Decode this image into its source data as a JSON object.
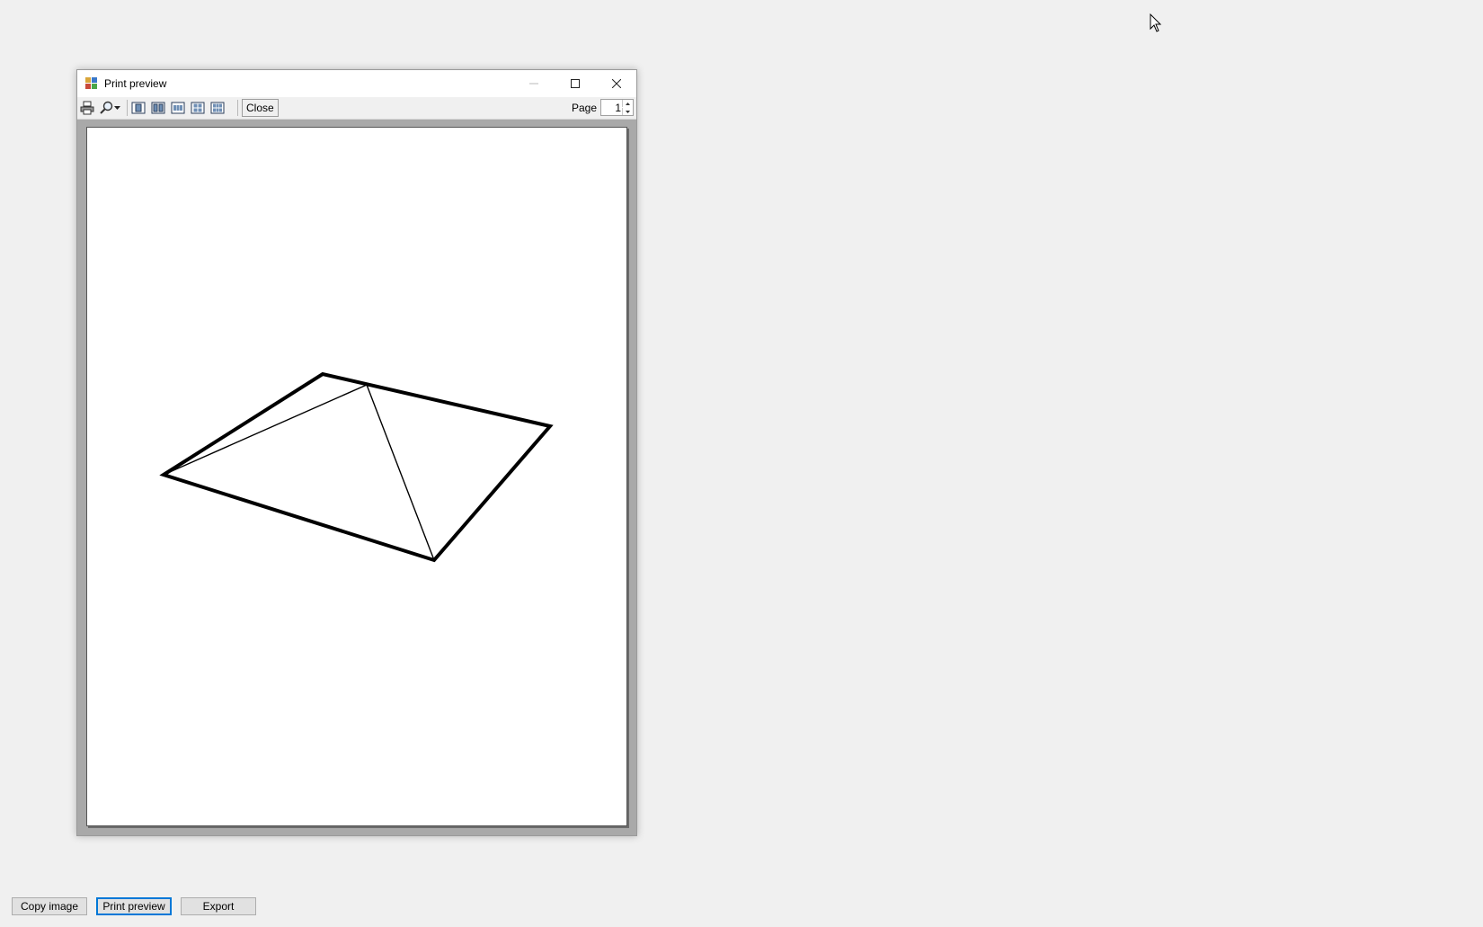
{
  "window": {
    "title": "Print preview",
    "controls": {
      "minimize": "—",
      "maximize": "☐",
      "close": "✕"
    }
  },
  "toolbar": {
    "icons": [
      "print-icon",
      "zoom-icon",
      "dropdown-arrow-icon",
      "one-page-icon",
      "two-pages-icon",
      "three-pages-icon",
      "four-pages-icon",
      "six-pages-icon"
    ],
    "close_label": "Close",
    "page_label": "Page",
    "page_value": "1"
  },
  "bottom_buttons": {
    "copy_image": "Copy image",
    "print_preview": "Print preview",
    "export": "Export"
  },
  "colors": {
    "background": "#f0f0f0",
    "preview_background": "#a9a9a9",
    "focus_accent": "#0078d7"
  }
}
